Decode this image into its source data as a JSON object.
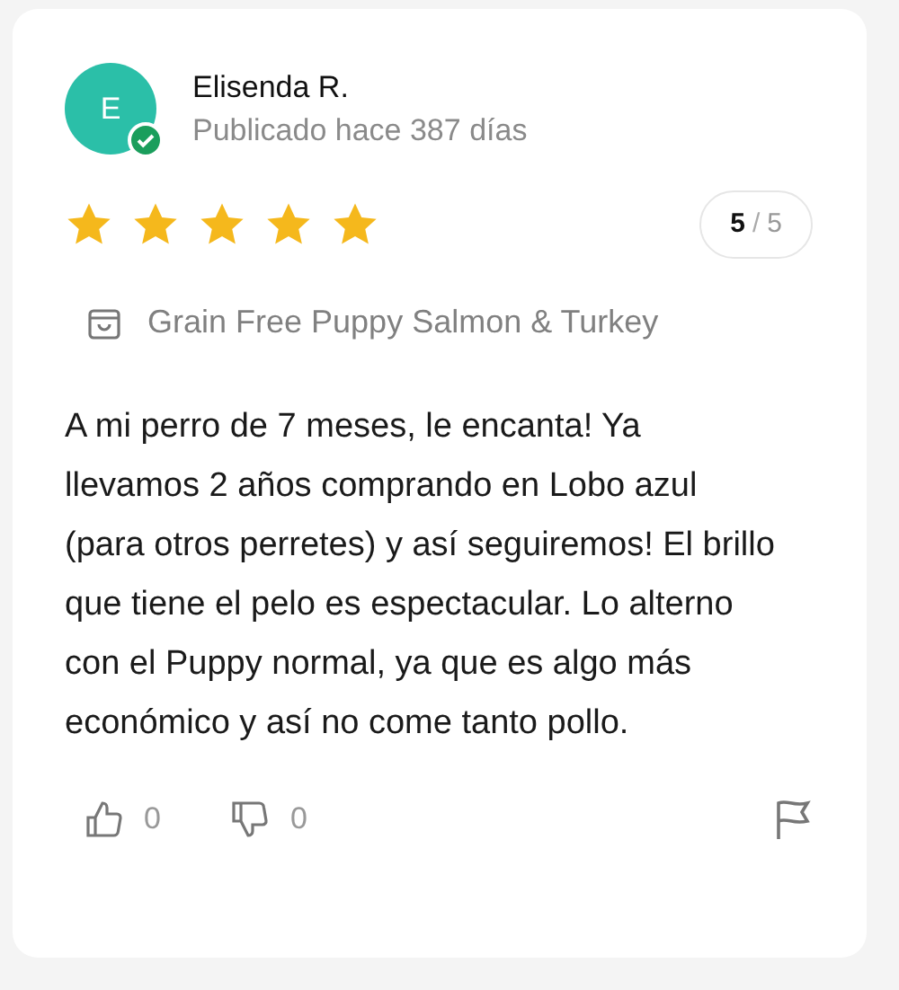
{
  "review": {
    "avatar_initial": "E",
    "verified": true,
    "author": "Elisenda R.",
    "posted": "Publicado hace 387 días",
    "stars": 5,
    "score": "5",
    "score_separator": "/",
    "score_total": "5",
    "product": "Grain Free Puppy Salmon & Turkey",
    "text": "A mi perro de 7 meses, le encanta! Ya llevamos 2 años comprando en Lobo azul (para otros perretes) y así seguiremos! El brillo que tiene el pelo es espectacular. Lo alterno con el Puppy normal, ya que es algo más económico y así no come tanto pollo.",
    "likes": "0",
    "dislikes": "0"
  }
}
